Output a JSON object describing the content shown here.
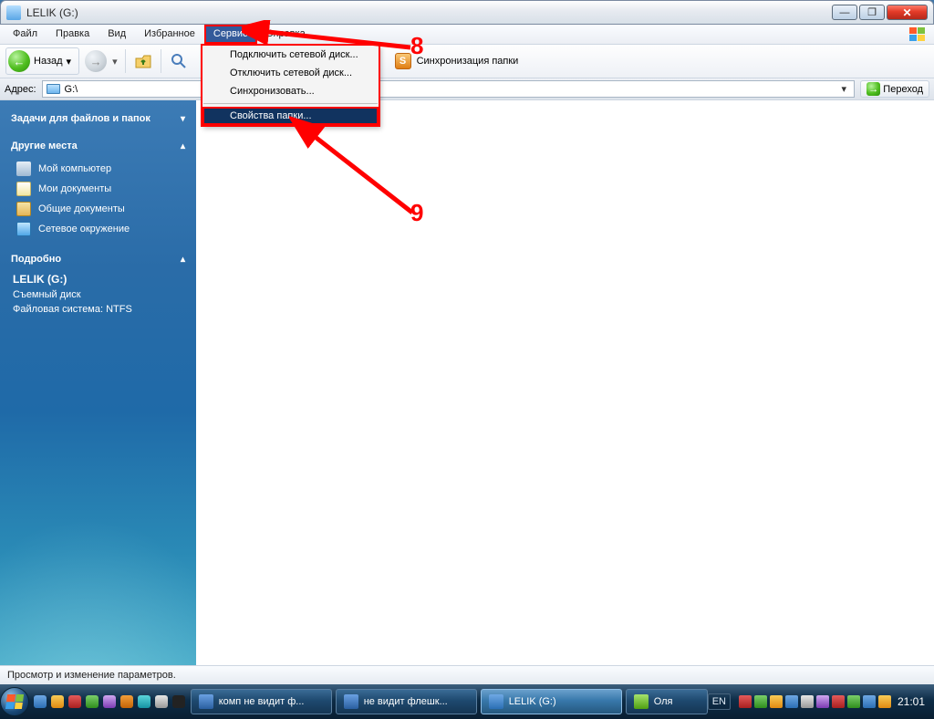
{
  "window": {
    "title": "LELIK (G:)"
  },
  "menu": {
    "file": "Файл",
    "edit": "Правка",
    "view": "Вид",
    "favorites": "Избранное",
    "tools": "Сервис",
    "help": "Справка"
  },
  "dropdown": {
    "mapDrive": "Подключить сетевой диск...",
    "disconnectDrive": "Отключить сетевой диск...",
    "sync": "Синхронизовать...",
    "folderOptions": "Свойства папки..."
  },
  "toolbar": {
    "back": "Назад",
    "syncFolder": "Синхронизация папки"
  },
  "address": {
    "label": "Адрес:",
    "path": "G:\\",
    "go": "Переход"
  },
  "sidebar": {
    "tasksHeader": "Задачи для файлов и папок",
    "placesHeader": "Другие места",
    "places": {
      "myComputer": "Мой компьютер",
      "myDocs": "Мои документы",
      "sharedDocs": "Общие документы",
      "network": "Сетевое окружение"
    },
    "detailsHeader": "Подробно",
    "details": {
      "name": "LELIK (G:)",
      "type": "Съемный диск",
      "fs": "Файловая система: NTFS"
    }
  },
  "status": "Просмотр и изменение параметров.",
  "taskbar": {
    "items": {
      "doc1": "комп не видит ф...",
      "doc2": "не видит флешк...",
      "explorer": "LELIK (G:)",
      "chat": "Оля"
    },
    "lang": "EN",
    "time": "21:01"
  },
  "annotations": {
    "n8": "8",
    "n9": "9"
  }
}
